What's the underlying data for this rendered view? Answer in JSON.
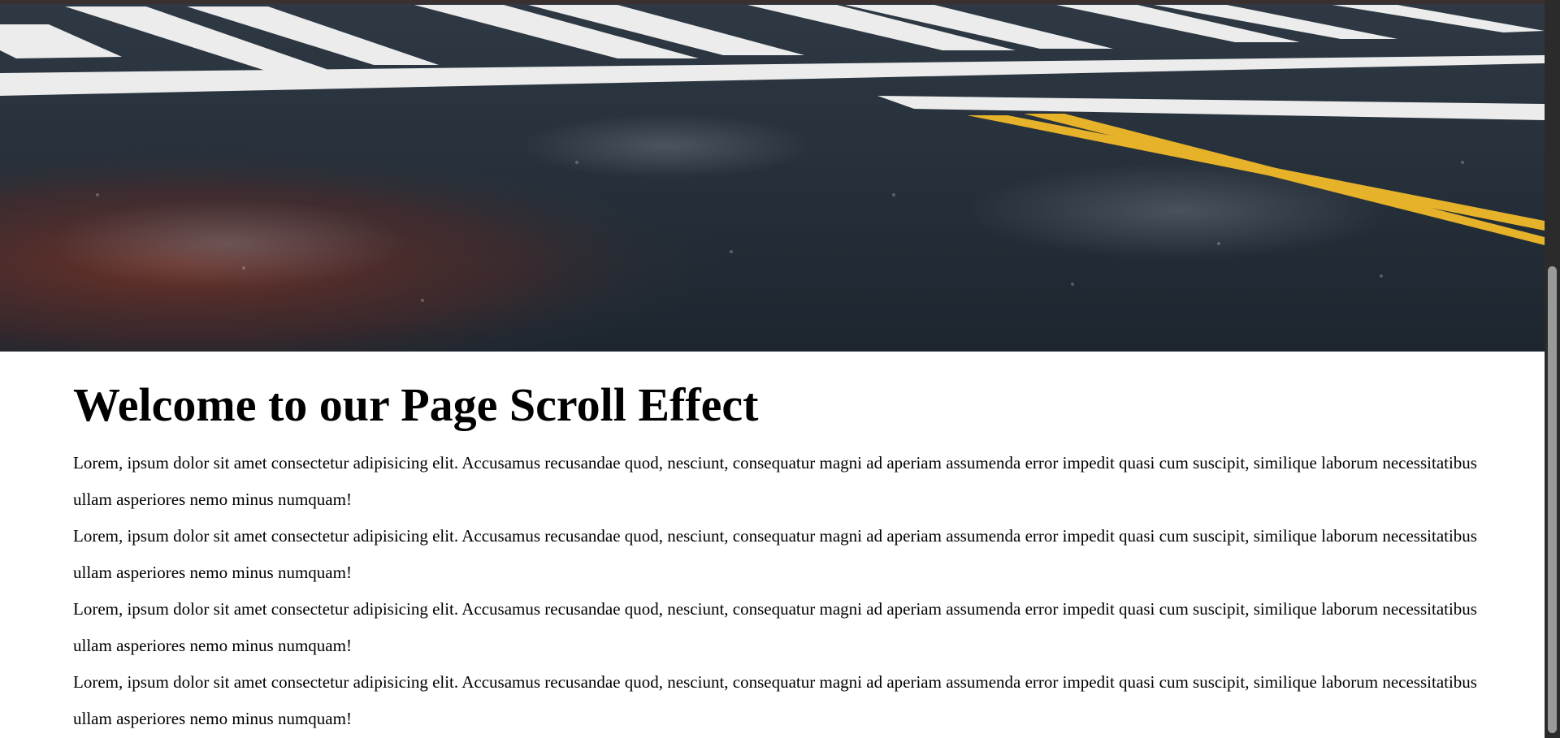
{
  "hero": {
    "image_description_icon": "road-crosswalk-photo",
    "colors": {
      "asphalt": "#27313b",
      "stripe": "#eeeeee",
      "yellow_line": "#e8b52a",
      "red_patch": "#8a3a2a"
    }
  },
  "content": {
    "heading": "Welcome to our Page Scroll Effect",
    "paragraphs": [
      "Lorem, ipsum dolor sit amet consectetur adipisicing elit. Accusamus recusandae quod, nesciunt, consequatur magni ad aperiam assumenda error impedit quasi cum suscipit, similique laborum necessitatibus ullam asperiores nemo minus numquam!",
      "Lorem, ipsum dolor sit amet consectetur adipisicing elit. Accusamus recusandae quod, nesciunt, consequatur magni ad aperiam assumenda error impedit quasi cum suscipit, similique laborum necessitatibus ullam asperiores nemo minus numquam!",
      "Lorem, ipsum dolor sit amet consectetur adipisicing elit. Accusamus recusandae quod, nesciunt, consequatur magni ad aperiam assumenda error impedit quasi cum suscipit, similique laborum necessitatibus ullam asperiores nemo minus numquam!",
      "Lorem, ipsum dolor sit amet consectetur adipisicing elit. Accusamus recusandae quod, nesciunt, consequatur magni ad aperiam assumenda error impedit quasi cum suscipit, similique laborum necessitatibus ullam asperiores nemo minus numquam!"
    ]
  },
  "scrollbar": {
    "position_fraction": 0.36
  }
}
